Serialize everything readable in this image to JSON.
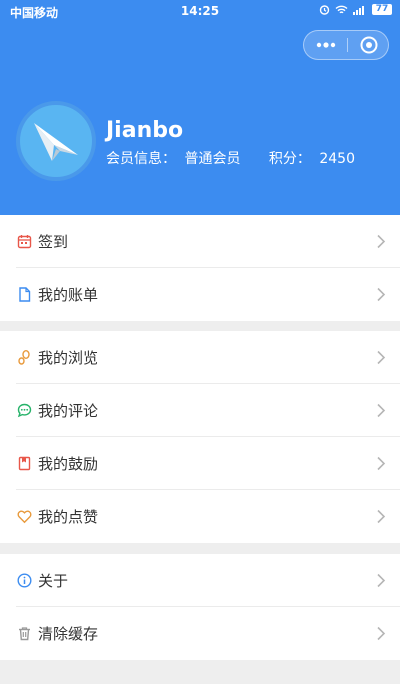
{
  "status_bar": {
    "carrier": "中国移动",
    "time": "14:25",
    "battery": "77"
  },
  "profile": {
    "name": "Jianbo",
    "member_label": "会员信息：",
    "member_level": "普通会员",
    "points_label": "积分：",
    "points_value": "2450"
  },
  "menu_groups": [
    [
      {
        "label": "签到",
        "icon": "calendar-icon"
      },
      {
        "label": "我的账单",
        "icon": "document-icon"
      }
    ],
    [
      {
        "label": "我的浏览",
        "icon": "footprint-icon"
      },
      {
        "label": "我的评论",
        "icon": "comment-icon"
      },
      {
        "label": "我的鼓励",
        "icon": "bookmark-icon"
      },
      {
        "label": "我的点赞",
        "icon": "heart-icon"
      }
    ],
    [
      {
        "label": "关于",
        "icon": "info-icon"
      },
      {
        "label": "清除缓存",
        "icon": "trash-icon"
      }
    ]
  ],
  "colors": {
    "header": "#3c8cf0",
    "calendar": "#e8574a",
    "document": "#3c8cf0",
    "footprint": "#e89a3c",
    "comment": "#27b36a",
    "bookmark": "#e8574a",
    "heart": "#e89a3c",
    "info": "#3c8cf0",
    "trash": "#999999"
  }
}
